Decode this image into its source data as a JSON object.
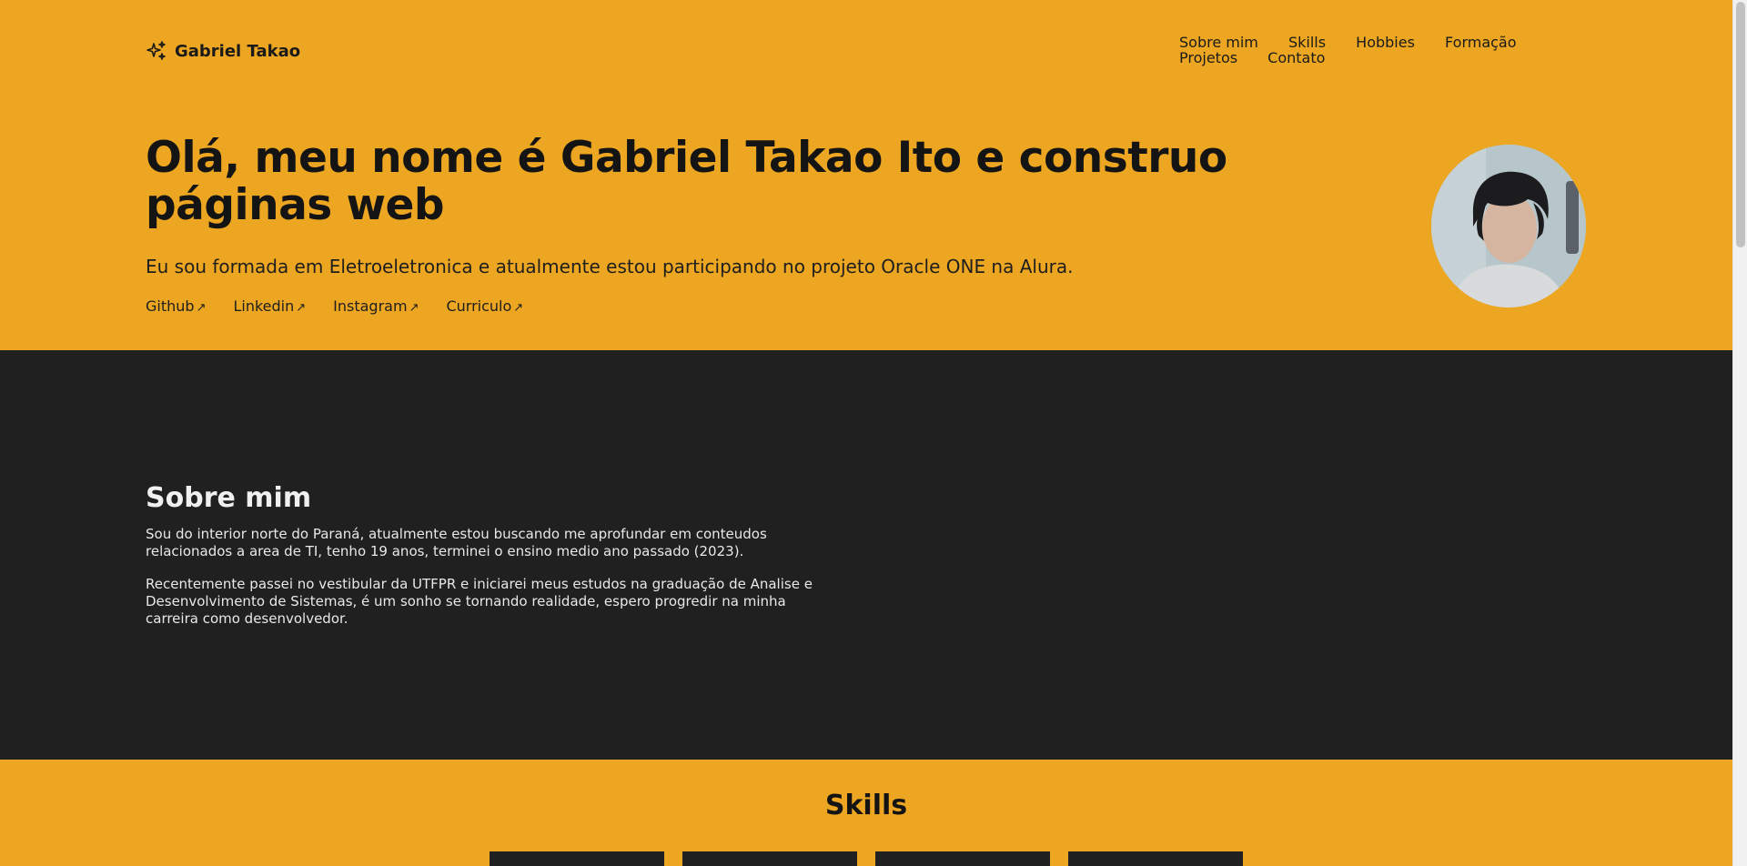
{
  "brand": {
    "name": "Gabriel Takao",
    "icon": "sparkles-icon"
  },
  "nav": {
    "items": [
      {
        "label": "Sobre mim"
      },
      {
        "label": "Skills"
      },
      {
        "label": "Hobbies"
      },
      {
        "label": "Formação"
      },
      {
        "label": "Projetos"
      },
      {
        "label": "Contato"
      }
    ]
  },
  "hero": {
    "headline": "Olá, meu nome é Gabriel Takao Ito e construo páginas web",
    "subtitle": "Eu sou formada em Eletroeletronica e atualmente estou participando no projeto Oracle ONE na Alura.",
    "links": [
      {
        "label": "Github",
        "arrow": "↗"
      },
      {
        "label": "Linkedin",
        "arrow": "↗"
      },
      {
        "label": "Instagram",
        "arrow": "↗"
      },
      {
        "label": "Curriculo",
        "arrow": "↗"
      }
    ]
  },
  "about": {
    "title": "Sobre mim",
    "paragraphs": [
      "Sou do interior norte do Paraná, atualmente estou buscando me aprofundar em conteudos relacionados a area de TI, tenho 19 anos, terminei o ensino medio ano passado (2023).",
      "Recentemente passei no vestibular da UTFPR e iniciarei meus estudos na graduação de Analise e Desenvolvimento de Sistemas, é um sonho se tornando realidade, espero progredir na minha carreira como desenvolvedor."
    ]
  },
  "skills": {
    "title": "Skills"
  },
  "colors": {
    "accent": "#eda621",
    "dark": "#202020"
  }
}
